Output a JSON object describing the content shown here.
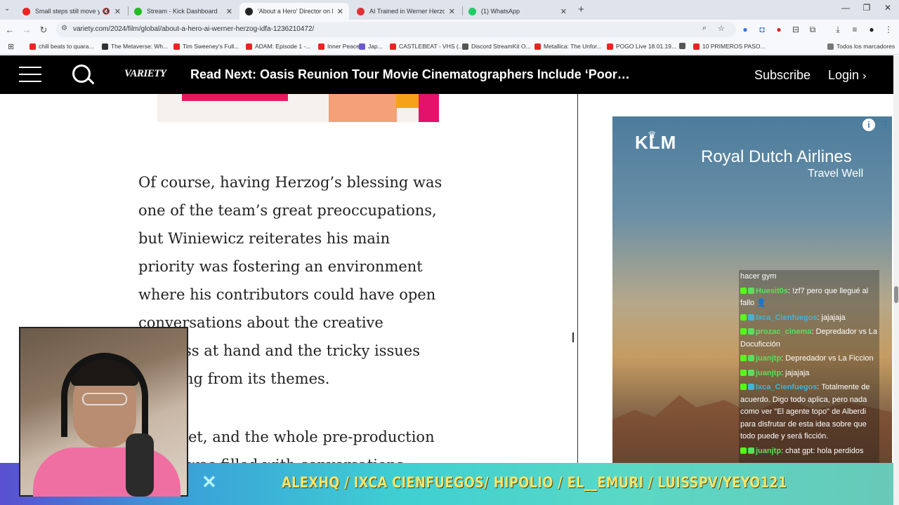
{
  "browser": {
    "tabs": [
      {
        "title": "Small steps still move you f",
        "fav_color": "#e22",
        "muted_icon": "🔇"
      },
      {
        "title": "Stream - Kick Dashboard",
        "fav_color": "#2b2"
      },
      {
        "title": "'About a Hero' Director on His",
        "fav_color": "#222",
        "active": true
      },
      {
        "title": "AI Trained in Werner Herzog W",
        "fav_color": "#d33"
      },
      {
        "title": "(1) WhatsApp",
        "fav_color": "#2c6"
      }
    ],
    "new_tab_icon": "+",
    "window_controls": [
      "—",
      "❐",
      "✕"
    ],
    "url": "variety.com/2024/film/global/about-a-hero-ai-werner-herzog-idfa-1236210472/",
    "bookmarks": [
      {
        "label": "chill beats to quara...",
        "color": "#e22"
      },
      {
        "label": "The Metaverse: Wh...",
        "color": "#333"
      },
      {
        "label": "Tim Sweeney's Full...",
        "color": "#e22"
      },
      {
        "label": "ADAM: Episode 1 -...",
        "color": "#e22"
      },
      {
        "label": "Inner Peace",
        "color": "#e22"
      },
      {
        "label": "Jap...",
        "color": "#6a5acd"
      },
      {
        "label": "CASTLEBEAT - VHS (...",
        "color": "#e22"
      },
      {
        "label": "Discord StreamKit O...",
        "color": "#555"
      },
      {
        "label": "Metallica: The Unfor...",
        "color": "#e22"
      },
      {
        "label": "POGO Live 18.01.19...",
        "color": "#e22"
      },
      {
        "label": "",
        "color": "#555"
      },
      {
        "label": "10 PRIMEROS PASO...",
        "color": "#e22"
      },
      {
        "label": "Todos los marcadores",
        "color": "#777"
      }
    ]
  },
  "site": {
    "logo": "VARIETY",
    "read_next": "Read Next: Oasis Reunion Tour Movie Cinematographers Include ‘Poor…",
    "subscribe": "Subscribe",
    "login": "Login"
  },
  "article": {
    "lines": [
      "Of course, having Herzog’s blessing was",
      "one of the team’s great preoccupations,",
      "but Winiewicz reiterates his main",
      "priority was fostering an environment",
      "where his contributors could have open",
      "conversations about the creative",
      "ss at hand and the tricky issues",
      "ng from its themes."
    ],
    "lines2": [
      "et, and the whole pre-production",
      "was filled with conversations"
    ]
  },
  "ad": {
    "logo": "KLM",
    "name": "Royal Dutch Airlines",
    "slogan": "Travel Well",
    "info_icon": "i",
    "menu_icon": "⋮"
  },
  "chat": {
    "header": "hacer gym",
    "messages": [
      {
        "user": "Huesit0s",
        "color": "#58e05a",
        "text": ": !zf7 pero que llegué al fallo 👤"
      },
      {
        "user": "Ixca_Cienfuegos",
        "color": "#3fb4d8",
        "text": ": jajajaja"
      },
      {
        "user": "prozac_cinema",
        "color": "#58e05a",
        "text": ": Depredador vs La Docuficción"
      },
      {
        "user": "juanjtp",
        "color": "#58e05a",
        "text": ": Depredador vs La Ficcion"
      },
      {
        "user": "juanjtp",
        "color": "#58e05a",
        "text": ": jajajaja"
      },
      {
        "user": "Ixca_Cienfuegos",
        "color": "#3fb4d8",
        "text": ": Totalmente de acuerdo. Digo todo aplica, pero nada como ver \"El agente topo\" de Alberdi para disfrutar de esta idea sobre que todo puede y será ficción."
      },
      {
        "user": "juanjtp",
        "color": "#58e05a",
        "text": ": chat gpt: hola perdidos"
      }
    ]
  },
  "overlay": {
    "band_text": "ALEXHQ / IXCA CIENFUEGOS/ HIPOLIO / EL__EMURI / LUISSPV/YEYO121",
    "close_icon": "✕"
  }
}
